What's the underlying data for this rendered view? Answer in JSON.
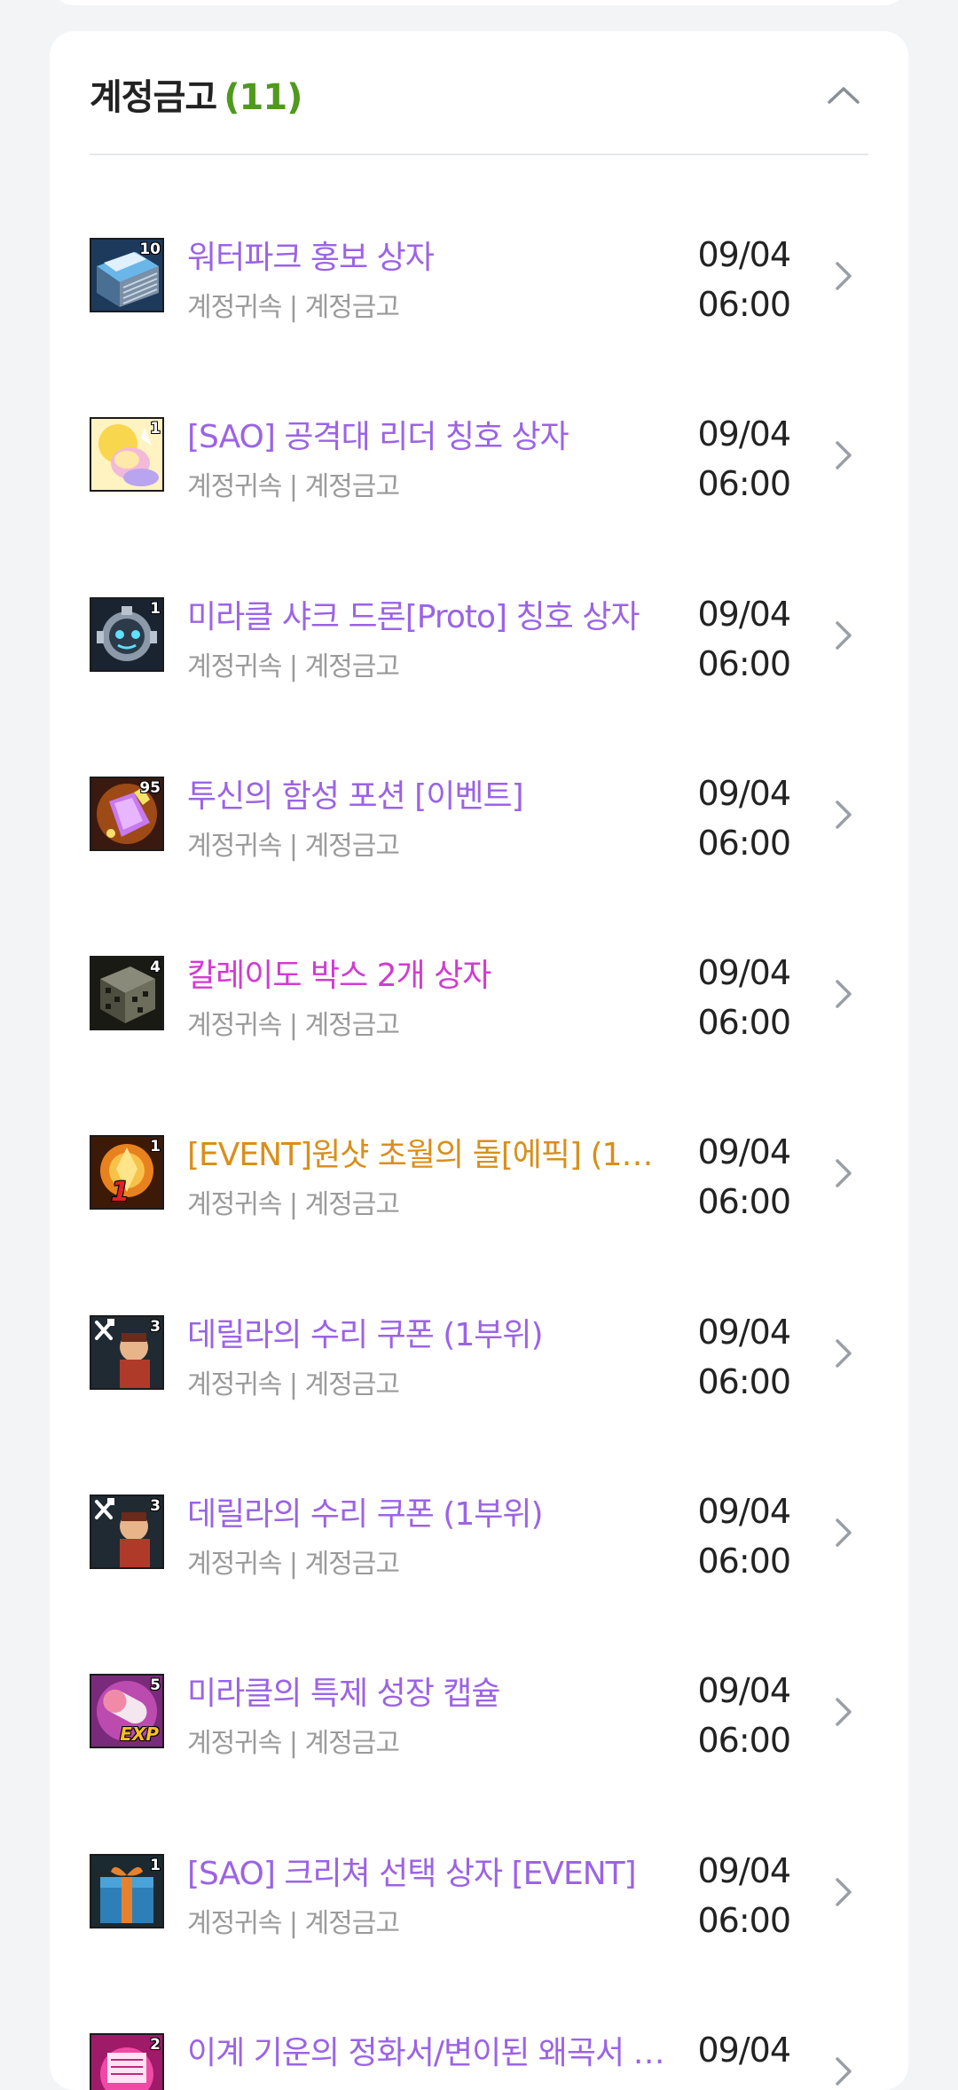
{
  "section": {
    "title": "계정금고",
    "count": "(11)"
  },
  "colors": {
    "purple": "#9b63e6",
    "magenta": "#d13bd1",
    "orange": "#d98f1a",
    "count_green": "#4f9a1c"
  },
  "items": [
    {
      "name": "워터파크 홍보 상자",
      "sub": "계정귀속 | 계정금고",
      "date": "09/04",
      "time": "06:00",
      "qty": "10",
      "color": "#9b63e6",
      "icon": "waterpark-box-icon"
    },
    {
      "name": "[SAO] 공격대 리더 칭호 상자",
      "sub": "계정귀속 | 계정금고",
      "date": "09/04",
      "time": "06:00",
      "qty": "1",
      "color": "#9b63e6",
      "icon": "title-box-icon"
    },
    {
      "name": "미라클 샤크 드론[Proto] 칭호 상자",
      "sub": "계정귀속 | 계정금고",
      "date": "09/04",
      "time": "06:00",
      "qty": "1",
      "color": "#9b63e6",
      "icon": "shark-drone-icon"
    },
    {
      "name": "투신의 함성 포션 [이벤트]",
      "sub": "계정귀속 | 계정금고",
      "date": "09/04",
      "time": "06:00",
      "qty": "95",
      "color": "#9b63e6",
      "icon": "potion-icon"
    },
    {
      "name": "칼레이도 박스 2개 상자",
      "sub": "계정귀속 | 계정금고",
      "date": "09/04",
      "time": "06:00",
      "qty": "4",
      "color": "#d13bd1",
      "icon": "kaleido-box-icon"
    },
    {
      "name": "[EVENT]원샷 초월의 돌[에픽] (11…",
      "sub": "계정귀속 | 계정금고",
      "date": "09/04",
      "time": "06:00",
      "qty": "1",
      "color": "#d98f1a",
      "icon": "transcend-stone-icon",
      "badge": "1"
    },
    {
      "name": "데릴라의 수리 쿠폰 (1부위)",
      "sub": "계정귀속 | 계정금고",
      "date": "09/04",
      "time": "06:00",
      "qty": "3",
      "color": "#9b63e6",
      "icon": "repair-coupon-icon"
    },
    {
      "name": "데릴라의 수리 쿠폰 (1부위)",
      "sub": "계정귀속 | 계정금고",
      "date": "09/04",
      "time": "06:00",
      "qty": "3",
      "color": "#9b63e6",
      "icon": "repair-coupon-icon"
    },
    {
      "name": "미라클의 특제 성장 캡슐",
      "sub": "계정귀속 | 계정금고",
      "date": "09/04",
      "time": "06:00",
      "qty": "5",
      "color": "#9b63e6",
      "icon": "exp-capsule-icon",
      "badge": "EXP"
    },
    {
      "name": "[SAO] 크리쳐 선택 상자 [EVENT]",
      "sub": "계정귀속 | 계정금고",
      "date": "09/04",
      "time": "06:00",
      "qty": "1",
      "color": "#9b63e6",
      "icon": "creature-box-icon"
    },
    {
      "name": "이계 기운의 정화서/변이된 왜곡서 …",
      "sub": "",
      "date": "09/04",
      "time": "",
      "qty": "2",
      "color": "#9b63e6",
      "icon": "purify-scroll-icon"
    }
  ]
}
